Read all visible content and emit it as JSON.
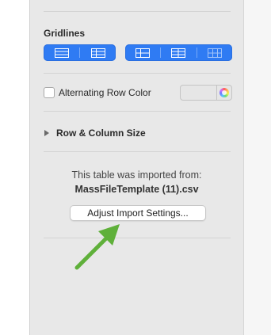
{
  "sidebar": {
    "gridlines_title": "Gridlines",
    "alternating_row_label": "Alternating Row Color",
    "alternating_row_checked": false,
    "row_column_size_label": "Row & Column Size",
    "import_info_line1": "This table was imported from:",
    "import_file_name": "MassFileTemplate (11).csv",
    "adjust_button_label": "Adjust Import Settings...",
    "accent_color": "#2f7bf3",
    "gridline_options_left": [
      "horizontal-gridlines-icon",
      "all-gridlines-icon"
    ],
    "gridline_options_right": [
      "header-column-gridlines-icon",
      "body-gridlines-icon",
      "footer-gridlines-icon"
    ]
  },
  "annotation": {
    "arrow_color": "#5fb03a"
  }
}
